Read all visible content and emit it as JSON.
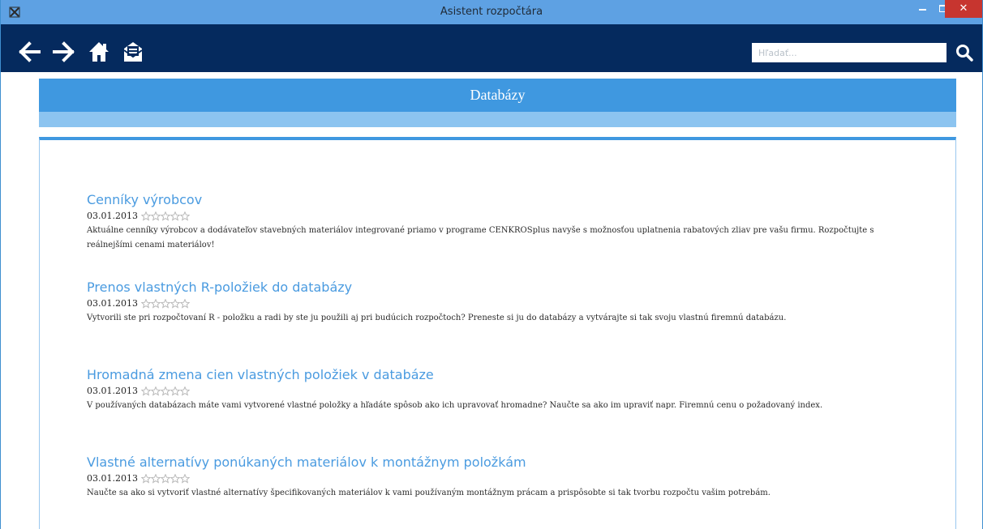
{
  "window": {
    "title": "Asistent rozpočtára",
    "app_icon": "app-icon",
    "close_symbol": "✕"
  },
  "toolbar": {
    "icons": [
      "back-arrow-icon",
      "forward-arrow-icon",
      "home-icon",
      "mail-icon"
    ],
    "search_placeholder": "Hľadať...",
    "search_icon": "search-icon"
  },
  "page": {
    "title": "Databázy"
  },
  "articles": [
    {
      "title": "Cenníky výrobcov",
      "date": "03.01.2013",
      "rating": 0,
      "description": "Aktuálne cenníky výrobcov a dodávateľov stavebných materiálov integrované priamo v programe CENKROSplus navyše s možnosťou uplatnenia rabatových zliav pre vašu firmu. Rozpočtujte s reálnejšími cenami materiálov!"
    },
    {
      "title": "Prenos vlastných R-položiek do databázy",
      "date": "03.01.2013",
      "rating": 0,
      "description": "Vytvorili ste pri rozpočtovaní R - položku a radi by ste ju použili aj pri budúcich rozpočtoch? Preneste si ju do databázy a vytvárajte si tak svoju vlastnú firemnú databázu."
    },
    {
      "title": "Hromadná zmena cien vlastných položiek v databáze",
      "date": "03.01.2013",
      "rating": 0,
      "description": "V používaných databázach máte vami vytvorené vlastné položky a hľadáte spôsob ako ich upravovať hromadne? Naučte sa ako im upraviť napr. Firemnú cenu o požadovaný index."
    },
    {
      "title": "Vlastné alternatívy ponúkaných materiálov k montážnym položkám",
      "date": "03.01.2013",
      "rating": 0,
      "description": "Naučte sa ako si vytvoriť vlastné alternatívy špecifikovaných materiálov k vami používaným montážnym prácam a prispôsobte si tak tvorbu rozpočtu vašim potrebám."
    }
  ],
  "colors": {
    "titlebar": "#5ea1e3",
    "toolbar": "#052a5e",
    "header": "#3f98e0",
    "subbar": "#8cc4f0",
    "link": "#4a9be0",
    "close": "#c7352f"
  }
}
